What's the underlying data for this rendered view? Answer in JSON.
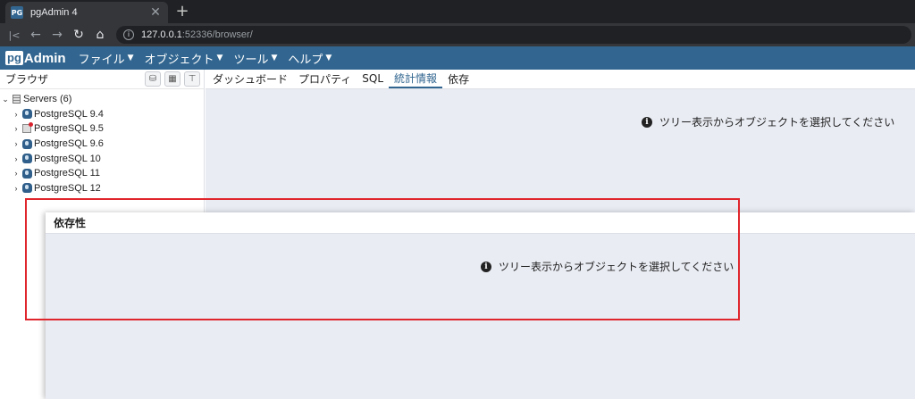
{
  "browser_chrome": {
    "tab_title": "pgAdmin 4",
    "favicon_text": "PG",
    "tab_close": "✕",
    "new_tab": "+",
    "url_host": "127.0.0.1",
    "url_path": ":52336/browser/"
  },
  "navbar": {
    "logo_pg": "pg",
    "logo_admin": "Admin",
    "menus": [
      "ファイル",
      "オブジェクト",
      "ツール",
      "ヘルプ"
    ]
  },
  "browser_panel": {
    "title": "ブラウザ",
    "servers_label": "Servers (6)",
    "servers": [
      {
        "name": "PostgreSQL 9.4",
        "connected": true
      },
      {
        "name": "PostgreSQL 9.5",
        "connected": false
      },
      {
        "name": "PostgreSQL 9.6",
        "connected": true
      },
      {
        "name": "PostgreSQL 10",
        "connected": true
      },
      {
        "name": "PostgreSQL 11",
        "connected": true
      },
      {
        "name": "PostgreSQL 12",
        "connected": true
      }
    ]
  },
  "main_panel": {
    "tabs": [
      "ダッシュボード",
      "プロパティ",
      "SQL",
      "統計情報",
      "依存"
    ],
    "active_tab": "統計情報",
    "message": "ツリー表示からオブジェクトを選択してください"
  },
  "dependents_panel": {
    "title": "依存性",
    "message": "ツリー表示からオブジェクトを選択してください"
  },
  "colors": {
    "brand": "#326690",
    "annotation": "#e0262d",
    "content_bg": "#e9ecf3"
  }
}
